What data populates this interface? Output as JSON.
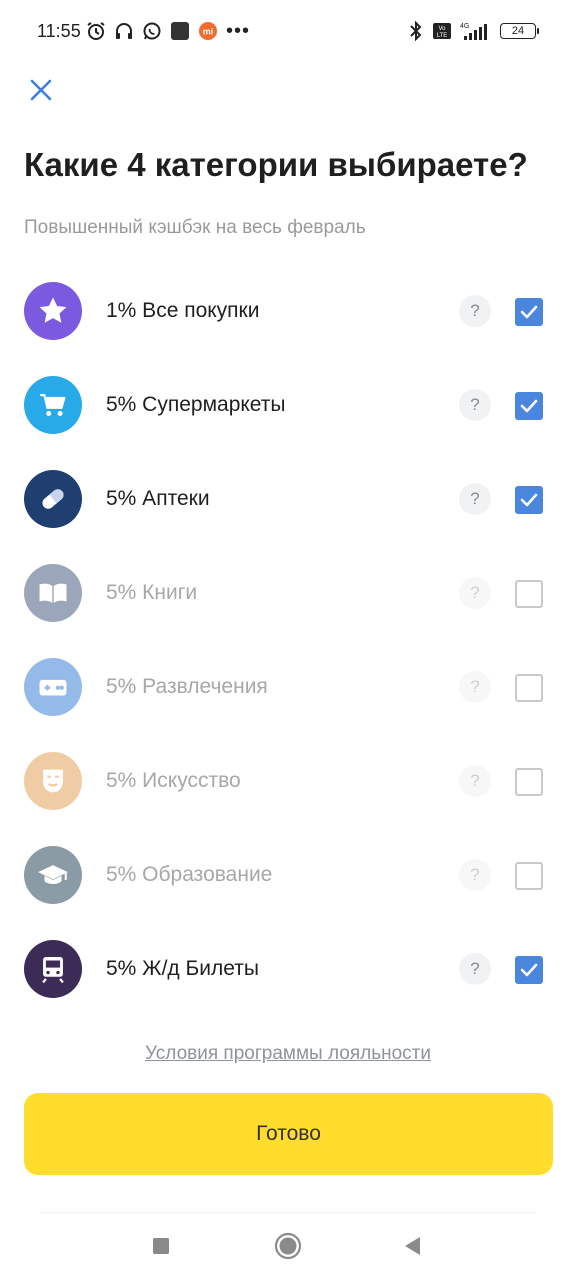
{
  "status_bar": {
    "time": "11:55",
    "battery": "24",
    "more": "•••",
    "icons_left": [
      "alarm-icon",
      "headphones-icon",
      "whatsapp-icon",
      "app-square-icon",
      "mi-icon"
    ],
    "icons_right": [
      "bluetooth-icon",
      "volte-icon",
      "signal-4g-icon",
      "battery-icon"
    ]
  },
  "header": {
    "title": "Какие 4 категории выбираете?",
    "subtitle": "Повышенный кэшбэк на весь февраль"
  },
  "categories": [
    {
      "label": "1% Все покупки",
      "icon": "star-icon",
      "checked": true,
      "color": "#7b5ae0"
    },
    {
      "label": "5% Супермаркеты",
      "icon": "cart-icon",
      "checked": true,
      "color": "#28a9e8"
    },
    {
      "label": "5% Аптеки",
      "icon": "pill-icon",
      "checked": true,
      "color": "#1f3f70"
    },
    {
      "label": "5% Книги",
      "icon": "book-icon",
      "checked": false,
      "color": "#4a5f82"
    },
    {
      "label": "5% Развлечения",
      "icon": "gamepad-icon",
      "checked": false,
      "color": "#3d82d8"
    },
    {
      "label": "5% Искусство",
      "icon": "theater-mask-icon",
      "checked": false,
      "color": "#e4a35a"
    },
    {
      "label": "5% Образование",
      "icon": "graduation-cap-icon",
      "checked": false,
      "color": "#2e4b5e"
    },
    {
      "label": "5% Ж/д Билеты",
      "icon": "train-icon",
      "checked": true,
      "color": "#3c2a57"
    }
  ],
  "help_symbol": "?",
  "terms_link": "Условия программы лояльности",
  "done_button": "Готово",
  "colors": {
    "accent_yellow": "#ffdd2d",
    "checkbox_blue": "#4a86de",
    "close_blue": "#3b7fe0"
  }
}
